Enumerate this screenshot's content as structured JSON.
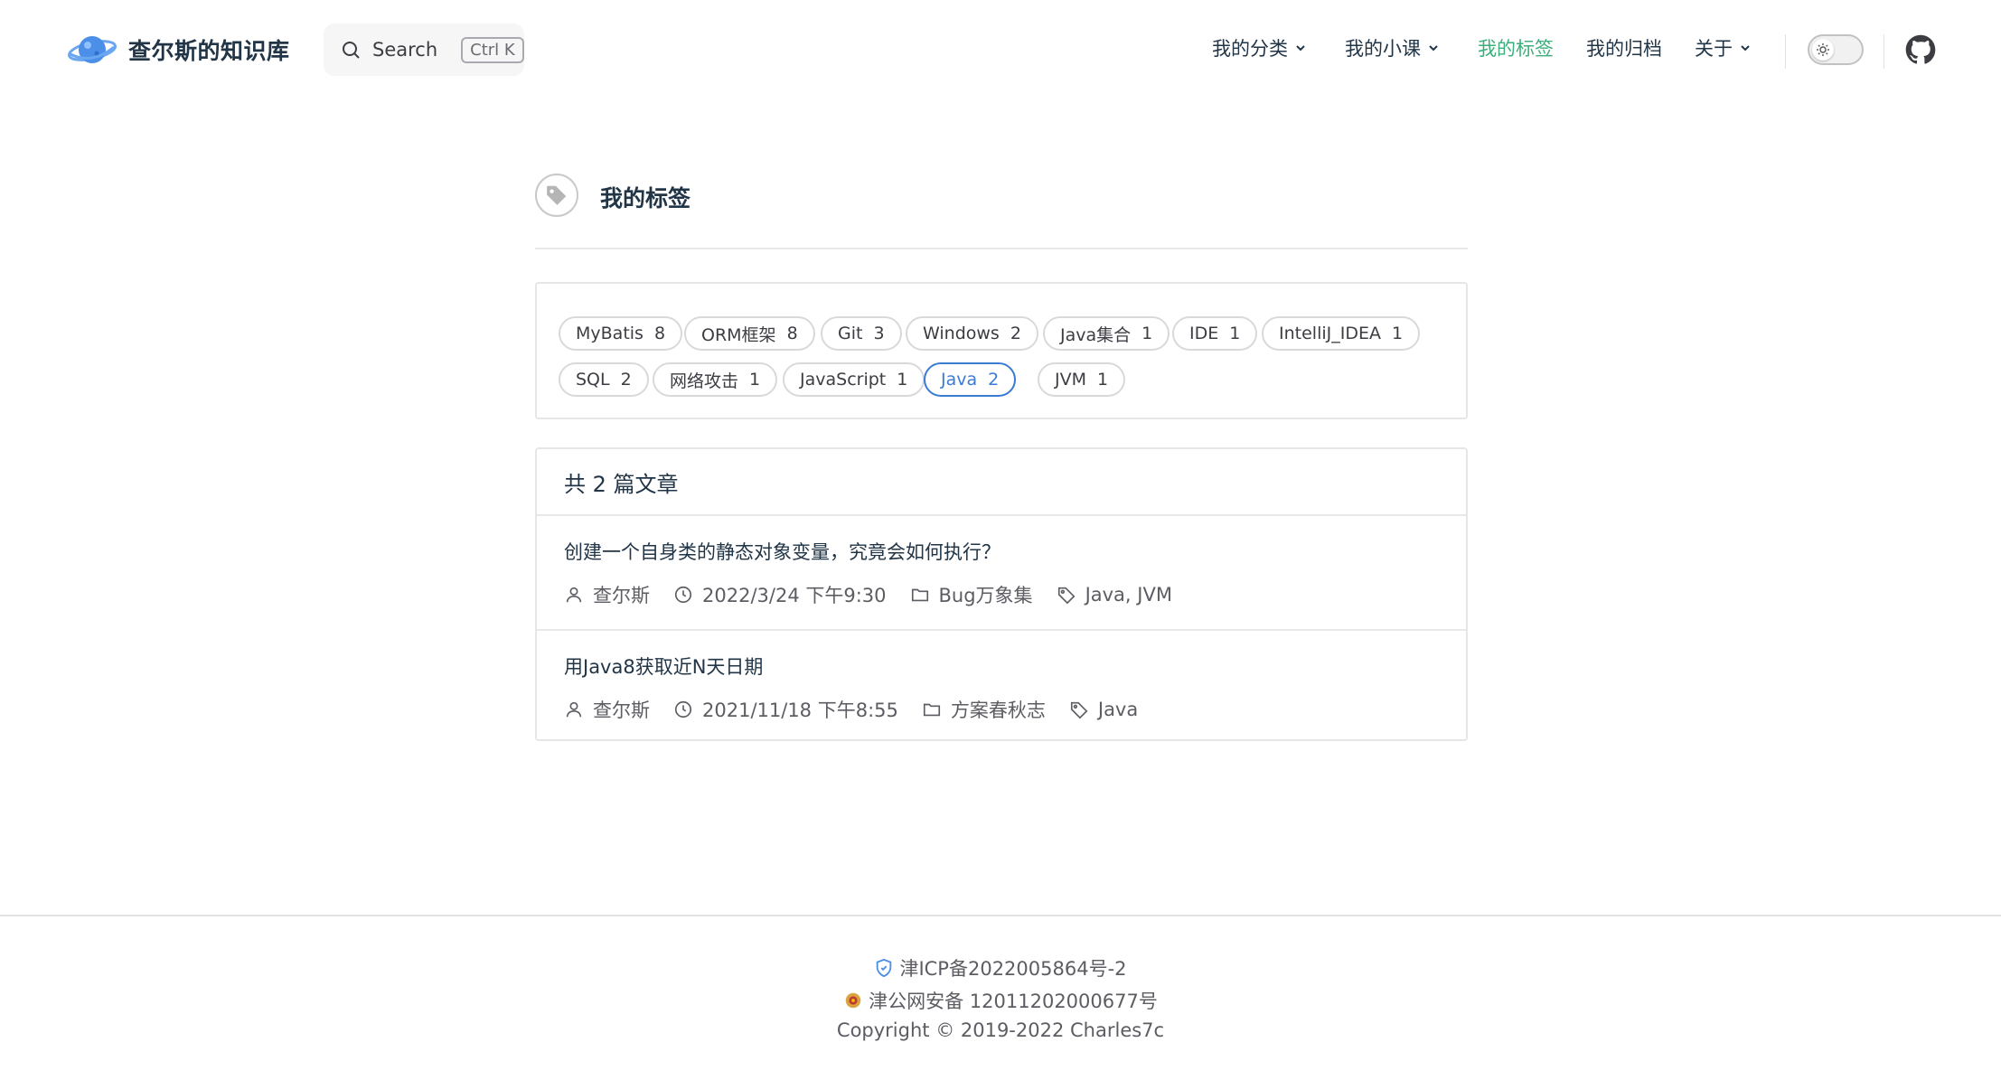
{
  "nav": {
    "brand": "查尔斯的知识库",
    "search_label": "Search",
    "search_kbd": "Ctrl K",
    "items": [
      {
        "label": "我的分类",
        "dropdown": true
      },
      {
        "label": "我的小课",
        "dropdown": true
      },
      {
        "label": "我的标签",
        "active": true
      },
      {
        "label": "我的归档"
      },
      {
        "label": "关于",
        "dropdown": true
      }
    ]
  },
  "page": {
    "title": "我的标签"
  },
  "tags": [
    {
      "name": "MyBatis",
      "count": "8"
    },
    {
      "name": "ORM框架",
      "count": "8"
    },
    {
      "name": "Git",
      "count": "3"
    },
    {
      "name": "Windows",
      "count": "2"
    },
    {
      "name": "Java集合",
      "count": "1"
    },
    {
      "name": "IDE",
      "count": "1"
    },
    {
      "name": "IntelliJ_IDEA",
      "count": "1"
    },
    {
      "name": "SQL",
      "count": "2"
    },
    {
      "name": "网络攻击",
      "count": "1"
    },
    {
      "name": "JavaScript",
      "count": "1"
    },
    {
      "name": "Java",
      "count": "2",
      "active": true
    },
    {
      "name": "JVM",
      "count": "1"
    }
  ],
  "articles_header": "共 2 篇文章",
  "articles": [
    {
      "title": "创建一个自身类的静态对象变量，究竟会如何执行？",
      "author": "查尔斯",
      "date": "2022/3/24 下午9:30",
      "category": "Bug万象集",
      "tags": "Java, JVM"
    },
    {
      "title": "用Java8获取近N天日期",
      "author": "查尔斯",
      "date": "2021/11/18 下午8:55",
      "category": "方案春秋志",
      "tags": "Java"
    }
  ],
  "footer": {
    "icp": "津ICP备2022005864号-2",
    "police": "津公网安备 12011202000677号",
    "copyright": "Copyright © 2019-2022 Charles7c"
  },
  "colors": {
    "accent_green": "#3eaf7c",
    "active_tag_blue": "#3a7bd5"
  }
}
